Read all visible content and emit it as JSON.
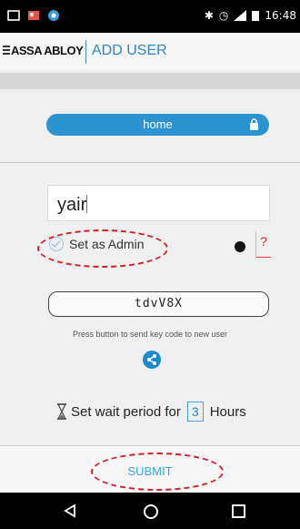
{
  "status_bar": {
    "time": "16:48",
    "icons": [
      "notification-icon",
      "gallery-icon",
      "settings-icon",
      "bluetooth-icon",
      "alarm-icon",
      "signal-icon",
      "battery-icon"
    ]
  },
  "app_bar": {
    "brand": "ASSA ABLOY",
    "title": "ADD USER"
  },
  "lock": {
    "name": "home",
    "icon": "lock-icon"
  },
  "user": {
    "name_value": "yair",
    "admin_label": "Set as Admin",
    "admin_checked": true,
    "help": "?"
  },
  "key_code": {
    "value": "tdvV8X",
    "hint": "Press button to send key code to new user",
    "share_icon": "share-icon"
  },
  "wait": {
    "prefix": "Set wait period for",
    "hours": "3",
    "suffix": "Hours"
  },
  "submit_label": "SUBMIT",
  "colors": {
    "accent": "#2b93cf",
    "annotation": "#d31e24"
  }
}
